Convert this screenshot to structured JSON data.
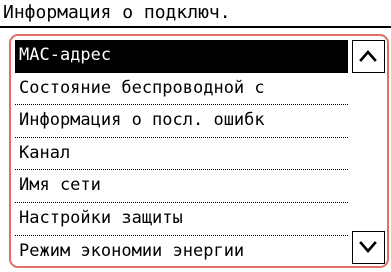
{
  "header": {
    "title": "Информация о подключ."
  },
  "menu": {
    "items": [
      {
        "label": "МАС-адрес",
        "selected": true
      },
      {
        "label": "Состояние беспроводной с",
        "selected": false
      },
      {
        "label": "Информация о посл. ошибк",
        "selected": false
      },
      {
        "label": "Канал",
        "selected": false
      },
      {
        "label": "Имя сети",
        "selected": false
      },
      {
        "label": "Настройки защиты",
        "selected": false
      },
      {
        "label": "Режим экономии энергии",
        "selected": false
      }
    ]
  },
  "scroll": {
    "up_icon": "chevron-up-icon",
    "down_icon": "chevron-down-icon"
  },
  "colors": {
    "panel_border": "#e0716a",
    "selected_bg": "#000000",
    "selected_fg": "#ffffff"
  }
}
